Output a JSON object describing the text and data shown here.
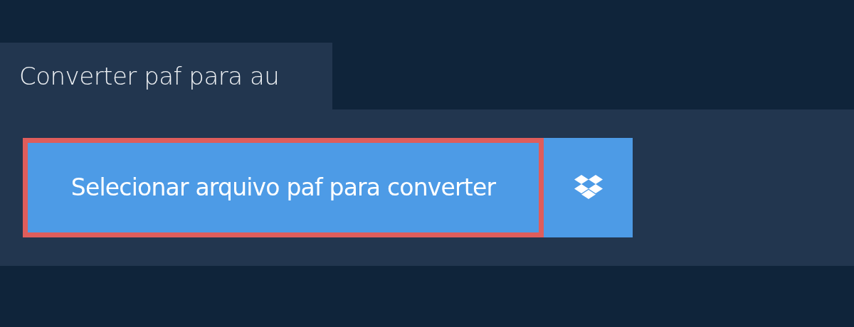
{
  "tab": {
    "label": "Converter paf para au"
  },
  "select_button": {
    "label": "Selecionar arquivo paf para converter",
    "focused": true
  }
}
